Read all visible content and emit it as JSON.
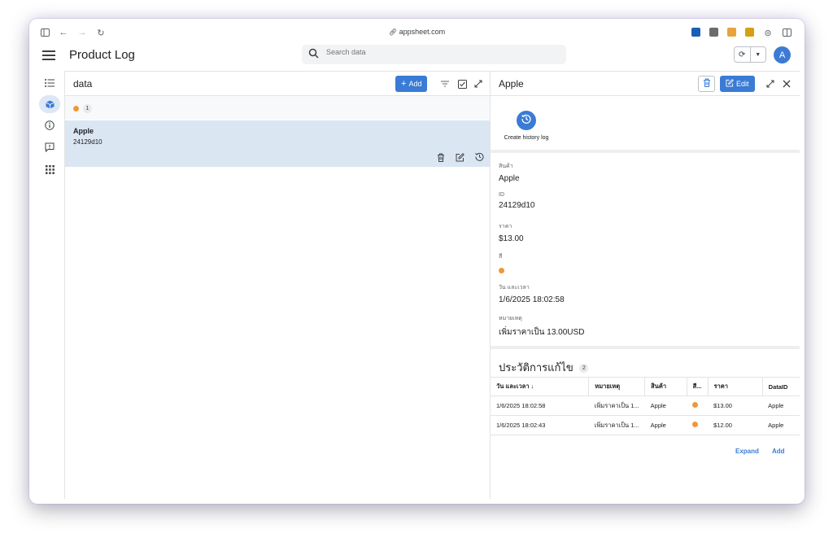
{
  "browser": {
    "url": "appsheet.com",
    "icons": [
      "sidebar-toggle-icon",
      "back-icon",
      "forward-icon",
      "reload-icon",
      "link-icon"
    ]
  },
  "header": {
    "title": "Product Log",
    "search_placeholder": "Search data",
    "avatar_initial": "A",
    "accent": "#3a7bd5"
  },
  "rail": {
    "icons": [
      "list-icon",
      "box-icon",
      "info-icon",
      "feedback-icon",
      "apps-grid-icon"
    ],
    "active_index": 1
  },
  "list": {
    "title": "data",
    "add_label": "Add",
    "group_count": "1",
    "group_color": "#f0973a",
    "rows": [
      {
        "name": "Apple",
        "id": "24129d10"
      }
    ]
  },
  "detail": {
    "title": "Apple",
    "edit_label": "Edit",
    "action_label": "Create history log",
    "fields": [
      {
        "label": "สินค้า",
        "value": "Apple"
      },
      {
        "label": "ID",
        "value": "24129d10"
      },
      {
        "label": "ราคา",
        "value": "$13.00"
      },
      {
        "label": "สี",
        "value": "",
        "color": "#f0973a"
      },
      {
        "label": "วัน และเวลา",
        "value": "1/6/2025 18:02:58"
      },
      {
        "label": "หมายเหตุ",
        "value": "เพิ่มราคาเป็น 13.00USD"
      }
    ],
    "history": {
      "title": "ประวัติการแก้ไข",
      "count": "2",
      "columns": [
        "วัน และเวลา ↓",
        "หมายเหตุ",
        "สินค้า",
        "สี...",
        "ราคา",
        "DataID"
      ],
      "rows": [
        {
          "date": "1/6/2025 18:02:58",
          "note": "เพิ่มราคาเป็น 1...",
          "product": "Apple",
          "color": "#f0973a",
          "price": "$13.00",
          "dataid": "Apple"
        },
        {
          "date": "1/6/2025 18:02:43",
          "note": "เพิ่มราคาเป็น 1...",
          "product": "Apple",
          "color": "#f0973a",
          "price": "$12.00",
          "dataid": "Apple"
        }
      ],
      "expand_label": "Expand",
      "add_label": "Add"
    }
  }
}
